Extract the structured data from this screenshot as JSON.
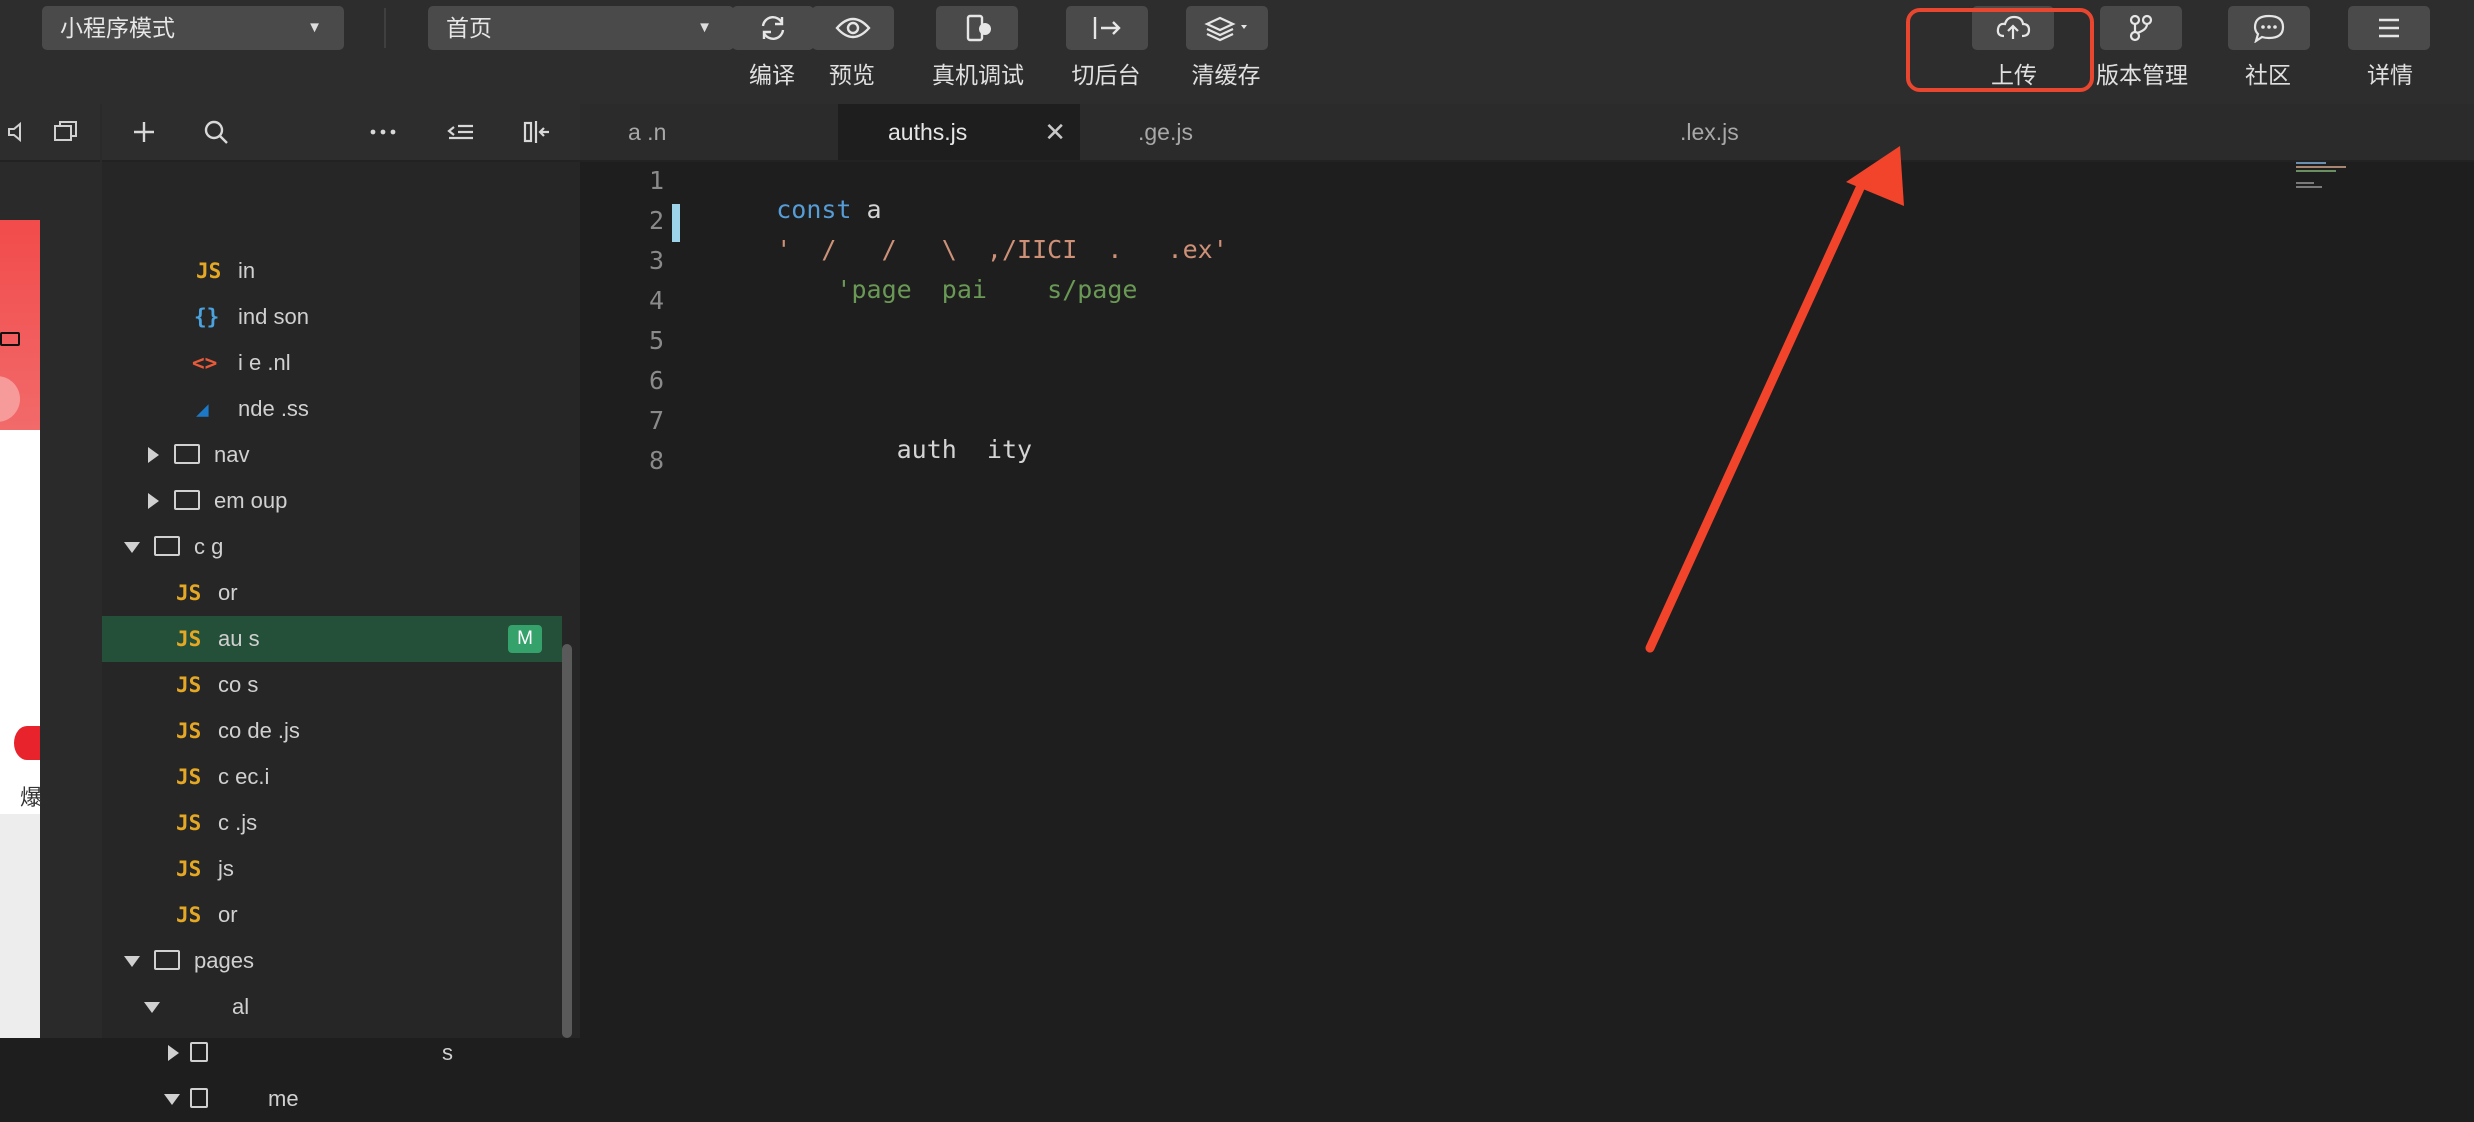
{
  "toolbar": {
    "mode_select": "小程序模式",
    "page_select": "首页",
    "buttons": {
      "compile": "编译",
      "preview": "预览",
      "remote_debug": "真机调试",
      "background": "切后台",
      "clear_cache": "清缓存",
      "upload": "上传",
      "version": "版本管理",
      "community": "社区",
      "details": "详情"
    }
  },
  "simulator": {
    "side_text": "爆"
  },
  "explorer": {
    "badge_modified": "M",
    "items": [
      {
        "icon": "JS",
        "label": "in"
      },
      {
        "icon": "{}",
        "label": "ind  son"
      },
      {
        "icon": "<>",
        "label": "i  e  .nl"
      },
      {
        "icon": "◢",
        "label": "nde  .ss"
      },
      {
        "label": "nav"
      },
      {
        "label": "em    oup"
      },
      {
        "label": "c  g"
      },
      {
        "icon": "JS",
        "label": "or"
      },
      {
        "icon": "JS",
        "label": "au  s"
      },
      {
        "icon": "JS",
        "label": "co   s"
      },
      {
        "icon": "JS",
        "label": "co    de  .js"
      },
      {
        "icon": "JS",
        "label": "c    ec.i"
      },
      {
        "icon": "JS",
        "label": "         c   .js"
      },
      {
        "icon": "JS",
        "label": "      js"
      },
      {
        "icon": "JS",
        "label": "or"
      },
      {
        "label": "pages"
      },
      {
        "label": "al"
      },
      {
        "label": "s"
      },
      {
        "label": "me"
      }
    ]
  },
  "editor": {
    "tabs": [
      {
        "label": "a    .n"
      },
      {
        "label": "auths.js"
      },
      {
        "label": "    .ge.js"
      },
      {
        "label": ""
      },
      {
        "label": ""
      },
      {
        "label": "   .lex.js"
      }
    ],
    "line_numbers": [
      "1",
      "2",
      "3",
      "4",
      "5",
      "6",
      "7",
      "8"
    ],
    "code_lines": [
      {
        "kw": "const",
        "rest": " a"
      },
      {
        "str": "'  /   /   \\  ,/IICI  .   .ex'"
      },
      {
        "grn": "    'page  pai    s/page"
      },
      {
        "plain": ""
      },
      {
        "plain": ""
      },
      {
        "plain": ""
      },
      {
        "plain": "        auth  ity"
      },
      {
        "plain": ""
      }
    ]
  },
  "colors": {
    "toolbar_bg": "#2d2d2d",
    "highlight": "#e8462f",
    "selected_row": "#24503a",
    "badge": "#34a26a"
  }
}
